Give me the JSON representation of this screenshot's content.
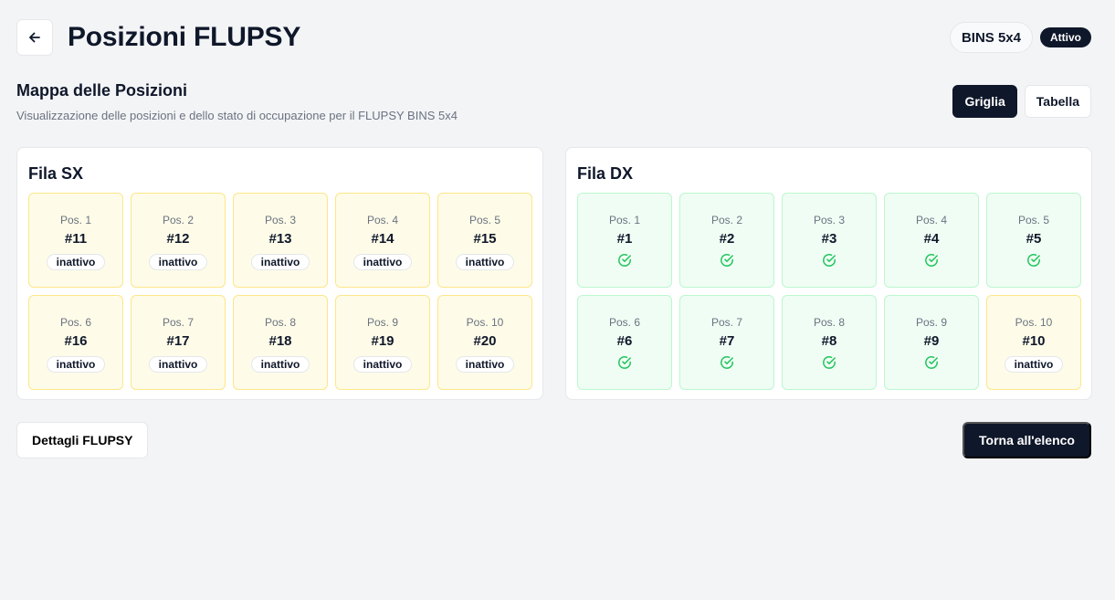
{
  "header": {
    "title": "Posizioni FLUPSY",
    "back_icon": "arrow-left-icon",
    "flupsy_name": "BINS 5x4",
    "status": "Attivo"
  },
  "map": {
    "title": "Mappa delle Posizioni",
    "description": "Visualizzazione delle posizioni e dello stato di occupazione per il FLUPSY BINS 5x4"
  },
  "view_toggle": {
    "grid_label": "Griglia",
    "table_label": "Tabella",
    "selected": "Griglia"
  },
  "rows": [
    {
      "title": "Fila SX",
      "positions": [
        {
          "label": "Pos. 1",
          "number": "#11",
          "state": "inactive",
          "status": "inattivo"
        },
        {
          "label": "Pos. 2",
          "number": "#12",
          "state": "inactive",
          "status": "inattivo"
        },
        {
          "label": "Pos. 3",
          "number": "#13",
          "state": "inactive",
          "status": "inattivo"
        },
        {
          "label": "Pos. 4",
          "number": "#14",
          "state": "inactive",
          "status": "inattivo"
        },
        {
          "label": "Pos. 5",
          "number": "#15",
          "state": "inactive",
          "status": "inattivo"
        },
        {
          "label": "Pos. 6",
          "number": "#16",
          "state": "inactive",
          "status": "inattivo"
        },
        {
          "label": "Pos. 7",
          "number": "#17",
          "state": "inactive",
          "status": "inattivo"
        },
        {
          "label": "Pos. 8",
          "number": "#18",
          "state": "inactive",
          "status": "inattivo"
        },
        {
          "label": "Pos. 9",
          "number": "#19",
          "state": "inactive",
          "status": "inattivo"
        },
        {
          "label": "Pos. 10",
          "number": "#20",
          "state": "inactive",
          "status": "inattivo"
        }
      ]
    },
    {
      "title": "Fila DX",
      "positions": [
        {
          "label": "Pos. 1",
          "number": "#1",
          "state": "active",
          "icon": "check-circle-icon"
        },
        {
          "label": "Pos. 2",
          "number": "#2",
          "state": "active",
          "icon": "check-circle-icon"
        },
        {
          "label": "Pos. 3",
          "number": "#3",
          "state": "active",
          "icon": "check-circle-icon"
        },
        {
          "label": "Pos. 4",
          "number": "#4",
          "state": "active",
          "icon": "check-circle-icon"
        },
        {
          "label": "Pos. 5",
          "number": "#5",
          "state": "active",
          "icon": "check-circle-icon"
        },
        {
          "label": "Pos. 6",
          "number": "#6",
          "state": "active",
          "icon": "check-circle-icon"
        },
        {
          "label": "Pos. 7",
          "number": "#7",
          "state": "active",
          "icon": "check-circle-icon"
        },
        {
          "label": "Pos. 8",
          "number": "#8",
          "state": "active",
          "icon": "check-circle-icon"
        },
        {
          "label": "Pos. 9",
          "number": "#9",
          "state": "active",
          "icon": "check-circle-icon"
        },
        {
          "label": "Pos. 10",
          "number": "#10",
          "state": "inactive",
          "status": "inattivo"
        }
      ]
    }
  ],
  "footer": {
    "details_label": "Dettagli FLUPSY",
    "back_label": "Torna all'elenco"
  },
  "colors": {
    "primary": "#0f172a",
    "inactive_bg": "#fefce8",
    "inactive_border": "#fde68a",
    "active_bg": "#f0fdf4",
    "active_border": "#bbf7d0",
    "check": "#22c55e"
  }
}
